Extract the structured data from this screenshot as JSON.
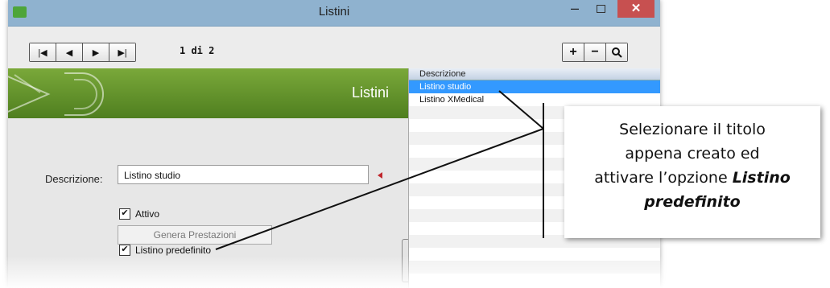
{
  "window": {
    "title": "Listini",
    "min_symbol": "–",
    "close_symbol": "✕"
  },
  "toolbar": {
    "nav_first": "|◀",
    "nav_prev": "◀",
    "nav_next": "▶",
    "nav_last": "▶|",
    "pager": "1 di 2",
    "add": "+",
    "remove": "−",
    "search": "⌕"
  },
  "banner": {
    "title": "Listini"
  },
  "form": {
    "descrizione_label": "Descrizione:",
    "descrizione_value": "Listino studio",
    "attivo_label": "Attivo",
    "attivo_checked": "✔",
    "predefinito_label": "Listino predefinito",
    "predefinito_checked": "✔",
    "genera_button": "Genera Prestazioni"
  },
  "list": {
    "header": "Descrizione",
    "rows": [
      "Listino studio",
      "Listino XMedical"
    ],
    "selected_index": 0
  },
  "callout": {
    "line1": "Selezionare il titolo",
    "line2": "appena creato ed",
    "line3_plain": "attivare l’opzione ",
    "line3_bold": "Listino",
    "line4_bold": "predefinito"
  },
  "colors": {
    "accent_green": "#5f8f2a",
    "selection_blue": "#3399ff",
    "close_red": "#c75050",
    "required_red": "#c0272d"
  }
}
